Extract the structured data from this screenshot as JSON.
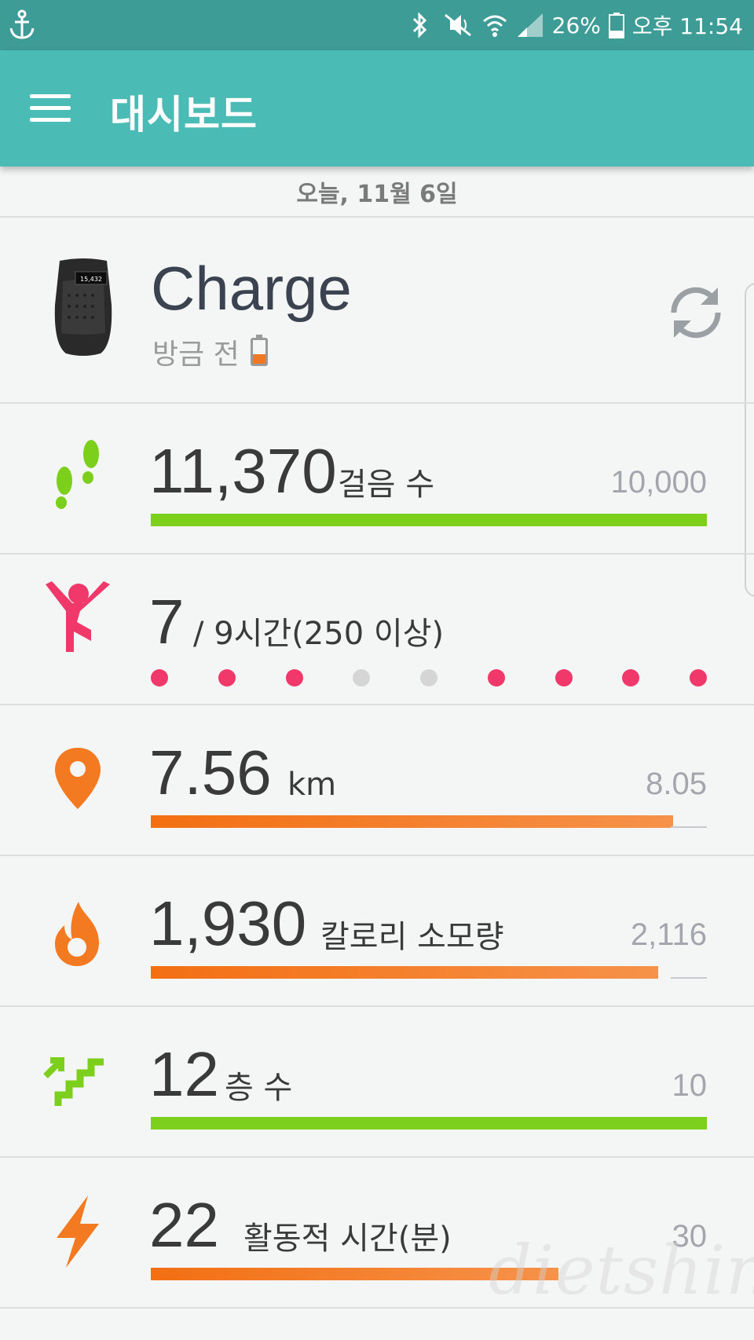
{
  "status_bar": {
    "battery_text": "26%",
    "time_text": "오후 11:54",
    "icons": [
      "anchor-icon",
      "bluetooth-icon",
      "mute-icon",
      "wifi-icon",
      "signal-icon",
      "battery-icon"
    ]
  },
  "header": {
    "title": "대시보드",
    "menu_icon": "menu-icon"
  },
  "date_label": "오늘, 11월 6일",
  "device": {
    "name": "Charge",
    "screen_text": "15,432",
    "sync_status": "방금 전",
    "battery_level": 0.4,
    "sync_icon": "sync-icon"
  },
  "stats": [
    {
      "id": "steps",
      "icon": "footsteps-icon",
      "value": "11,370",
      "unit": "걸음 수",
      "goal": "10,000",
      "progress": 1.0,
      "color": "#7ccf1a"
    },
    {
      "id": "hourly",
      "icon": "active-person-icon",
      "value": "7",
      "unit": "/ 9시간(250 이상)",
      "hours": [
        true,
        true,
        true,
        false,
        false,
        true,
        true,
        true,
        true
      ],
      "color": "#f0386b",
      "inactive_color": "#d5d5d5"
    },
    {
      "id": "distance",
      "icon": "location-pin-icon",
      "value": "7.56",
      "unit": "km",
      "goal": "8.05",
      "progress": 0.939,
      "color": "#f37a20"
    },
    {
      "id": "calories",
      "icon": "flame-icon",
      "value": "1,930",
      "unit": "칼로리 소모량",
      "goal": "2,116",
      "progress": 0.912,
      "color": "#f37a20"
    },
    {
      "id": "floors",
      "icon": "stairs-icon",
      "value": "12",
      "unit": "층 수",
      "goal": "10",
      "progress": 1.0,
      "color": "#7ccf1a"
    },
    {
      "id": "active",
      "icon": "lightning-icon",
      "value": "22",
      "unit": "활동적 시간(분)",
      "goal": "30",
      "progress": 0.733,
      "color": "#f37a20"
    }
  ],
  "watermark": "dietshin.com"
}
